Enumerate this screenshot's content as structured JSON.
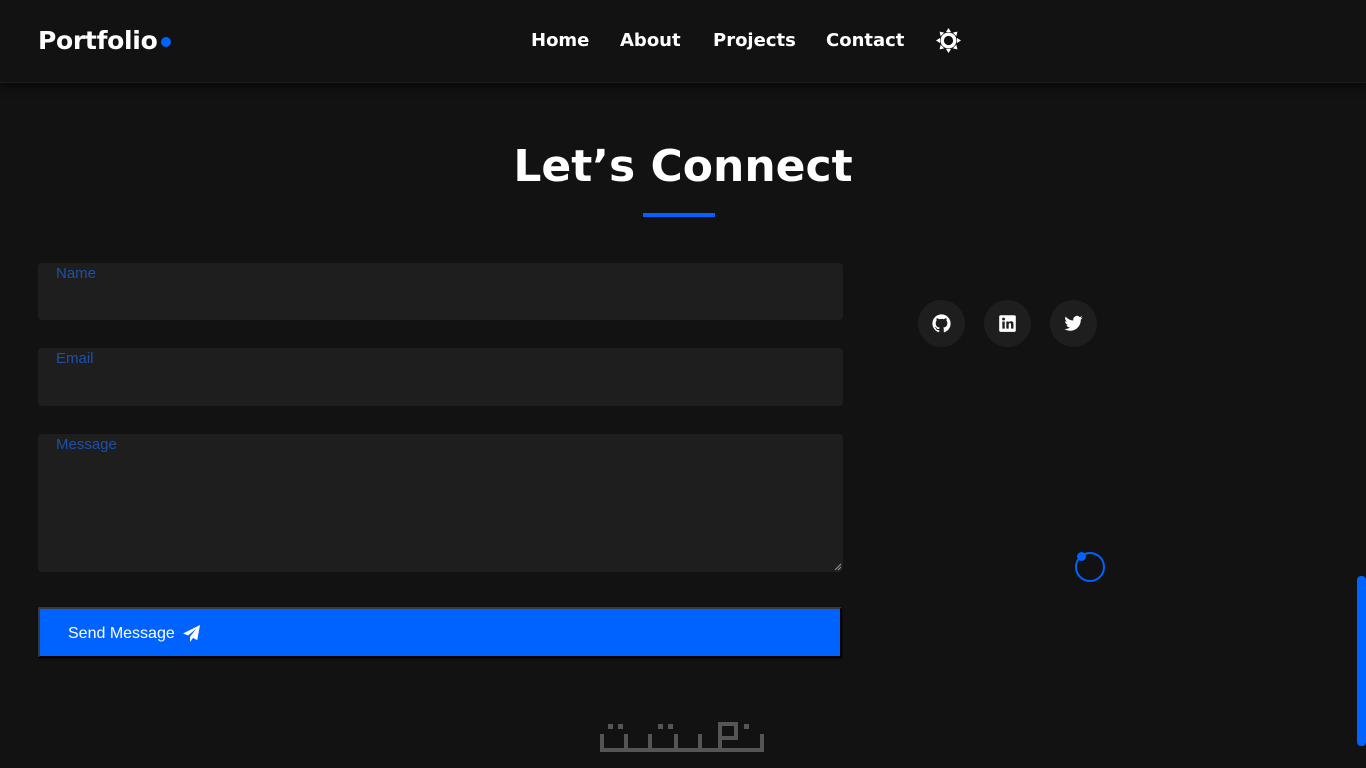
{
  "navbar": {
    "brand": "Portfolio",
    "links": [
      {
        "label": "Home"
      },
      {
        "label": "About"
      },
      {
        "label": "Projects"
      },
      {
        "label": "Contact"
      }
    ],
    "theme_icon": "sun-icon"
  },
  "contact": {
    "title": "Let’s Connect",
    "fields": {
      "name": {
        "label": "Name",
        "value": ""
      },
      "email": {
        "label": "Email",
        "value": ""
      },
      "message": {
        "label": "Message",
        "value": ""
      }
    },
    "submit_label": "Send Message",
    "submit_icon": "paper-plane-icon"
  },
  "social": [
    {
      "icon": "github-icon"
    },
    {
      "icon": "linkedin-icon"
    },
    {
      "icon": "twitter-icon"
    }
  ],
  "watermark": "خمسات",
  "colors": {
    "accent": "#0062ff",
    "background": "#121212",
    "surface": "#1e1e1e",
    "label": "#1f4fa8"
  }
}
